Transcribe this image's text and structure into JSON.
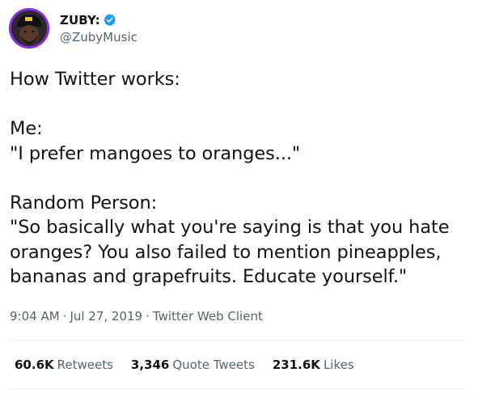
{
  "author": {
    "display_name": "ZUBY:",
    "handle": "@ZubyMusic",
    "verified_icon": "verified-badge-icon",
    "accent_color": "#1d9bf0",
    "avatar_color": "#8a2be2"
  },
  "tweet": {
    "lines": [
      "How Twitter works:",
      "",
      "Me:",
      "\"I prefer mangoes to oranges...\"",
      "",
      "Random Person:",
      "\"So basically what you're saying is that you hate",
      "oranges? You also failed to mention pineapples,",
      "bananas and grapefruits. Educate yourself.\""
    ]
  },
  "meta": {
    "time": "9:04 AM",
    "date": "Jul 27, 2019",
    "client": "Twitter Web Client",
    "separator": "·"
  },
  "stats": {
    "retweets_count": "60.6K",
    "retweets_label": "Retweets",
    "quote_count": "3,346",
    "quote_label": "Quote Tweets",
    "likes_count": "231.6K",
    "likes_label": "Likes"
  }
}
